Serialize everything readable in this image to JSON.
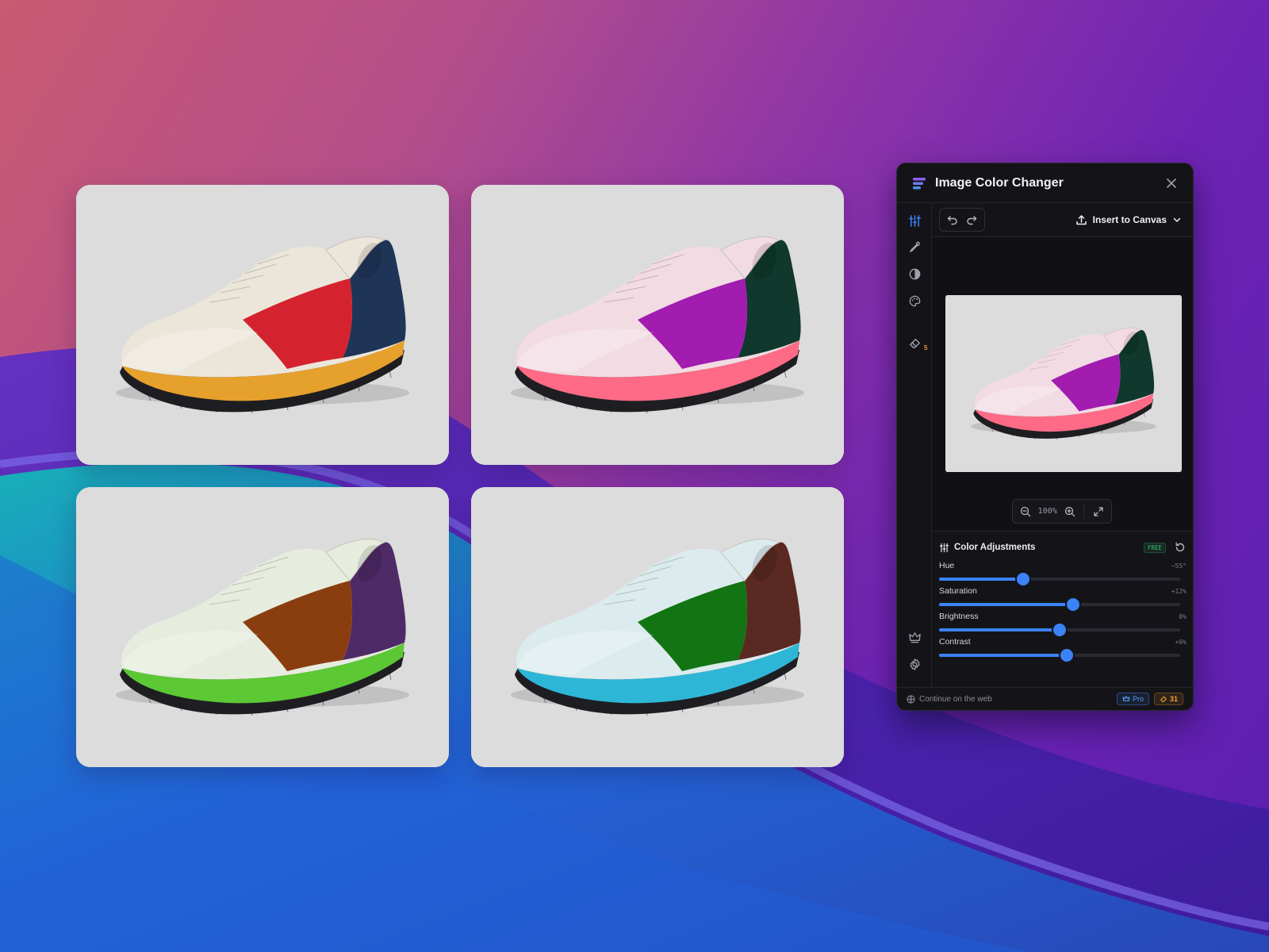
{
  "panel": {
    "title": "Image Color Changer",
    "insert_label": "Insert to Canvas",
    "zoom": "100%",
    "rail_badge": "5",
    "adjustments": {
      "title": "Color Adjustments",
      "badge": "FREE",
      "sliders": [
        {
          "label": "Hue",
          "value": "−55°",
          "level": 0.35
        },
        {
          "label": "Saturation",
          "value": "+12%",
          "level": 0.556
        },
        {
          "label": "Brightness",
          "value": "0%",
          "level": 0.5
        },
        {
          "label": "Contrast",
          "value": "+6%",
          "level": 0.53
        }
      ]
    },
    "footer": {
      "link": "Continue on the web",
      "pro": "Pro",
      "credits": "31"
    }
  },
  "shoes": [
    {
      "name": "cream-red",
      "upper": "#ece6da",
      "accent": "#d4232f",
      "heel": "#1f3558",
      "sole": "#e6a02c"
    },
    {
      "name": "pink-magenta",
      "upper": "#f2dbe2",
      "accent": "#a21cb0",
      "heel": "#10382c",
      "sole": "#ff6a86"
    },
    {
      "name": "mint-brown",
      "upper": "#e6edde",
      "accent": "#8a3e10",
      "heel": "#4e2a66",
      "sole": "#5cc834"
    },
    {
      "name": "ice-green",
      "upper": "#dcebee",
      "accent": "#127412",
      "heel": "#5a2a22",
      "sole": "#2eb6d6"
    }
  ],
  "preview_shoe": {
    "upper": "#f2dbe2",
    "accent": "#a21cb0",
    "heel": "#10382c",
    "sole": "#ff6a86"
  },
  "colors": {
    "accent": "#3b82f6",
    "panel_bg": "#141418"
  }
}
